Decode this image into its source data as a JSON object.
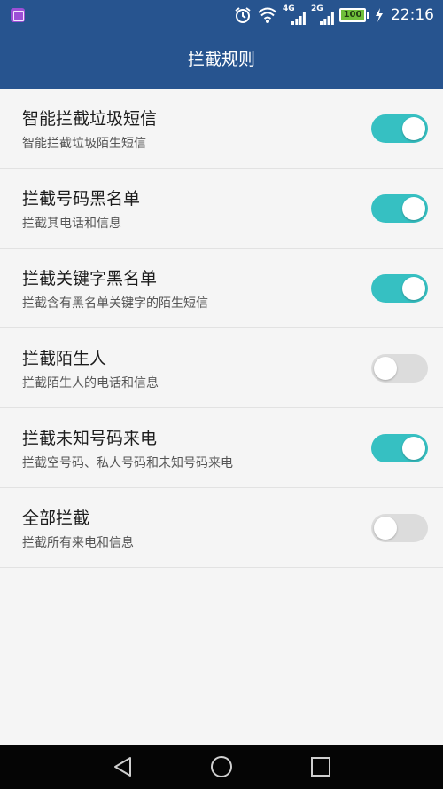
{
  "status_bar": {
    "time": "22:16",
    "battery": "100",
    "net1_tag": "4G",
    "net2_tag": "2G",
    "icons": [
      "app-notification-icon",
      "alarm-icon",
      "wifi-icon",
      "signal-4g-icon",
      "signal-2g-icon",
      "battery-icon",
      "charging-icon"
    ]
  },
  "app_bar": {
    "title": "拦截规则"
  },
  "rules": [
    {
      "title": "智能拦截垃圾短信",
      "subtitle": "智能拦截垃圾陌生短信",
      "enabled": true
    },
    {
      "title": "拦截号码黑名单",
      "subtitle": "拦截其电话和信息",
      "enabled": true
    },
    {
      "title": "拦截关键字黑名单",
      "subtitle": "拦截含有黑名单关键字的陌生短信",
      "enabled": true
    },
    {
      "title": "拦截陌生人",
      "subtitle": "拦截陌生人的电话和信息",
      "enabled": false
    },
    {
      "title": "拦截未知号码来电",
      "subtitle": "拦截空号码、私人号码和未知号码来电",
      "enabled": true
    },
    {
      "title": "全部拦截",
      "subtitle": "拦截所有来电和信息",
      "enabled": false
    }
  ],
  "nav_bar": {
    "icons": [
      "back-icon",
      "home-icon",
      "recents-icon"
    ]
  },
  "colors": {
    "app_bar": "#27548f",
    "switch_on": "#36c0c2",
    "switch_off": "#dcdcdc",
    "background": "#f5f5f5"
  }
}
